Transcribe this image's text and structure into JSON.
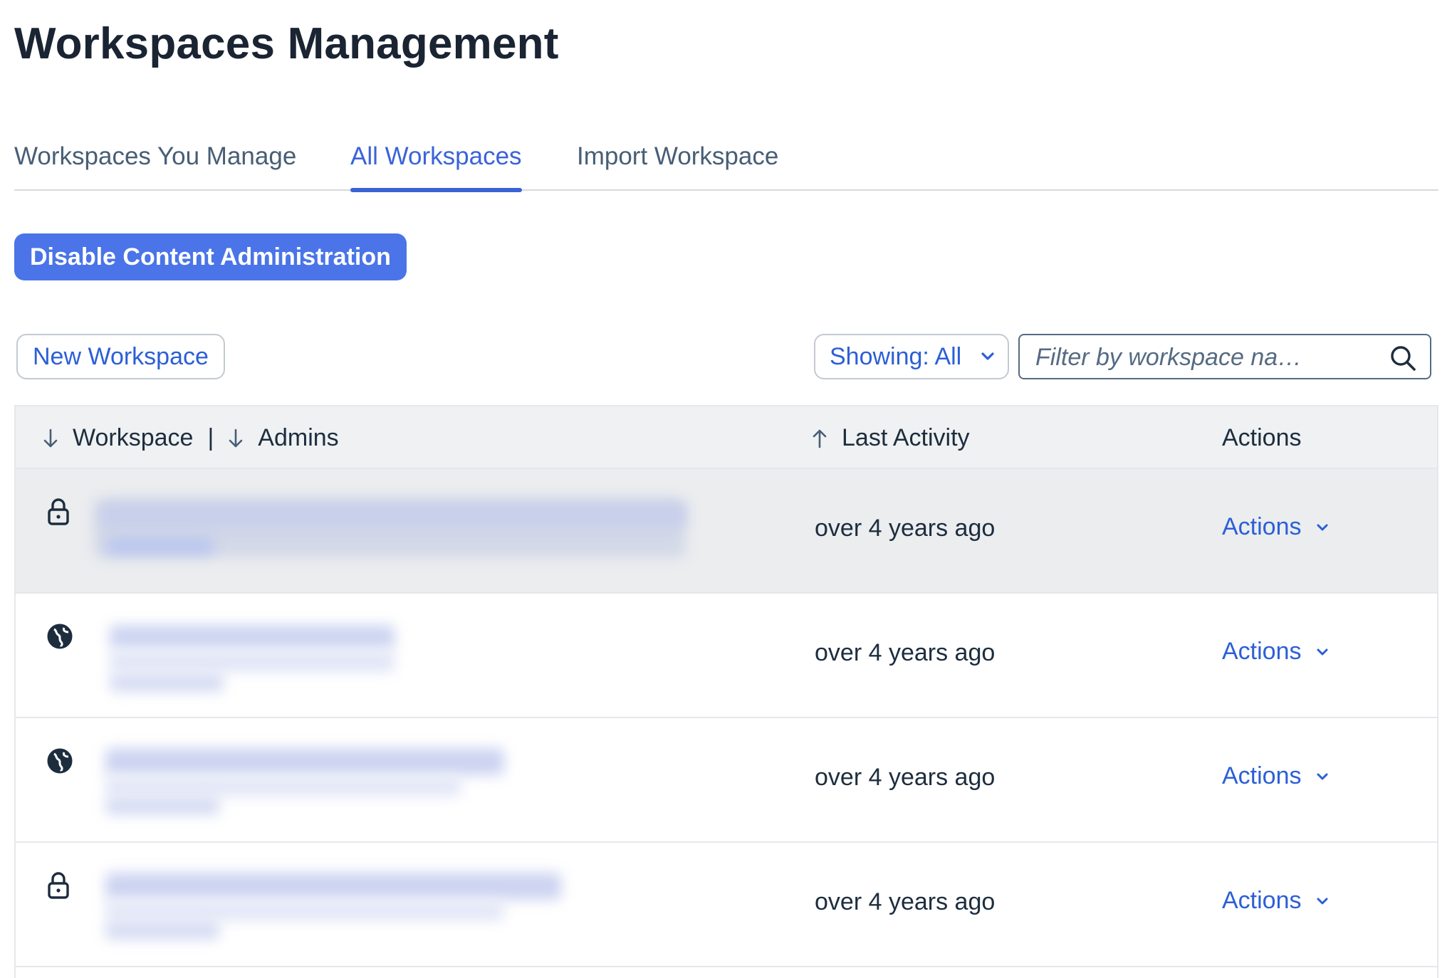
{
  "page": {
    "title": "Workspaces Management"
  },
  "tabs": [
    {
      "label": "Workspaces You Manage",
      "active": false
    },
    {
      "label": "All Workspaces",
      "active": true
    },
    {
      "label": "Import Workspace",
      "active": false
    }
  ],
  "primary_button": {
    "label": "Disable Content Administration"
  },
  "toolbar": {
    "new_workspace_label": "New Workspace",
    "showing_label": "Showing: All",
    "search_placeholder": "Filter by workspace na…"
  },
  "table": {
    "columns": {
      "workspace": "Workspace",
      "separator": "|",
      "admins": "Admins",
      "last_activity": "Last Activity",
      "actions": "Actions"
    },
    "rows": [
      {
        "visibility_icon": "lock-icon",
        "last_activity": "over 4 years ago",
        "actions_label": "Actions",
        "selected": true
      },
      {
        "visibility_icon": "globe-icon",
        "last_activity": "over 4 years ago",
        "actions_label": "Actions",
        "selected": false
      },
      {
        "visibility_icon": "globe-icon",
        "last_activity": "over 4 years ago",
        "actions_label": "Actions",
        "selected": false
      },
      {
        "visibility_icon": "lock-icon",
        "last_activity": "over 4 years ago",
        "actions_label": "Actions",
        "selected": false
      }
    ]
  },
  "colors": {
    "accent": "#3b63d8",
    "primary_button": "#4a74e8",
    "link": "#2c5fd6",
    "header_bg": "#eff1f2",
    "selected_row_bg": "#ebedef",
    "redaction_blur": "#c9d2f0"
  }
}
